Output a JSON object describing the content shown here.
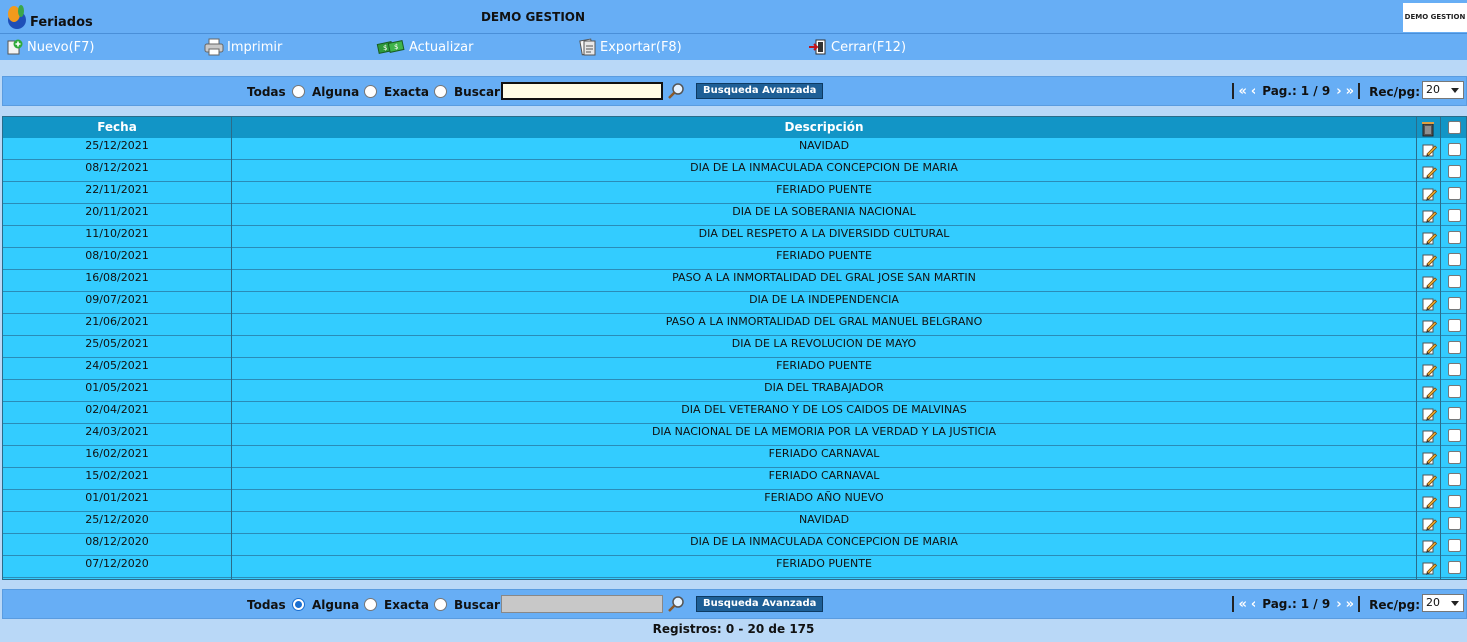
{
  "window": {
    "title": "Feriados",
    "app_name": "DEMO GESTION",
    "brand": "DEMO GESTION"
  },
  "toolbar": {
    "new": "Nuevo(F7)",
    "print": "Imprimir",
    "refresh": "Actualizar",
    "export": "Exportar(F8)",
    "close": "Cerrar(F12)"
  },
  "search": {
    "all": "Todas",
    "any": "Alguna",
    "exact": "Exacta",
    "find": "Buscar",
    "advanced": "Busqueda Avanzada",
    "top_value": "",
    "bottom_value": ""
  },
  "pager": {
    "label": "Pag.:",
    "current": "1",
    "separator": "/",
    "total": "9",
    "rec_label": "Rec/pg:",
    "rec_value": "20"
  },
  "grid": {
    "headers": {
      "date": "Fecha",
      "description": "Descripción"
    },
    "rows": [
      {
        "date": "25/12/2021",
        "desc": "NAVIDAD"
      },
      {
        "date": "08/12/2021",
        "desc": "DIA DE LA INMACULADA CONCEPCION DE MARIA"
      },
      {
        "date": "22/11/2021",
        "desc": "FERIADO PUENTE"
      },
      {
        "date": "20/11/2021",
        "desc": "DIA DE LA SOBERANIA NACIONAL"
      },
      {
        "date": "11/10/2021",
        "desc": "DIA DEL RESPETO A LA DIVERSIDD CULTURAL"
      },
      {
        "date": "08/10/2021",
        "desc": "FERIADO PUENTE"
      },
      {
        "date": "16/08/2021",
        "desc": "PASO A LA INMORTALIDAD DEL GRAL JOSE SAN MARTIN"
      },
      {
        "date": "09/07/2021",
        "desc": "DIA DE LA INDEPENDENCIA"
      },
      {
        "date": "21/06/2021",
        "desc": "PASO A LA INMORTALIDAD DEL GRAL MANUEL BELGRANO"
      },
      {
        "date": "25/05/2021",
        "desc": "DIA DE LA REVOLUCION DE MAYO"
      },
      {
        "date": "24/05/2021",
        "desc": "FERIADO PUENTE"
      },
      {
        "date": "01/05/2021",
        "desc": "DIA DEL TRABAJADOR"
      },
      {
        "date": "02/04/2021",
        "desc": "DIA DEL VETERANO Y DE LOS CAIDOS DE MALVINAS"
      },
      {
        "date": "24/03/2021",
        "desc": "DIA NACIONAL DE LA MEMORIA POR LA VERDAD Y LA JUSTICIA"
      },
      {
        "date": "16/02/2021",
        "desc": "FERIADO CARNAVAL"
      },
      {
        "date": "15/02/2021",
        "desc": "FERIADO CARNAVAL"
      },
      {
        "date": "01/01/2021",
        "desc": "FERIADO AÑO NUEVO"
      },
      {
        "date": "25/12/2020",
        "desc": "NAVIDAD"
      },
      {
        "date": "08/12/2020",
        "desc": "DIA DE LA INMACULADA CONCEPCION DE MARIA"
      },
      {
        "date": "07/12/2020",
        "desc": "FERIADO PUENTE"
      }
    ]
  },
  "footer": {
    "records": "Registros: 0 - 20 de 175"
  },
  "icons": {
    "logo": "app-logo-icon",
    "new": "add-document-icon",
    "print": "printer-icon",
    "refresh": "refresh-money-icon",
    "export": "export-icon",
    "close": "exit-door-icon",
    "search": "magnifier-icon",
    "delete": "trash-icon",
    "edit": "edit-pencil-icon"
  },
  "colors": {
    "bar": "#67aef5",
    "grid": "#33ccff",
    "header": "#1295c6",
    "button": "#1e5f96"
  }
}
